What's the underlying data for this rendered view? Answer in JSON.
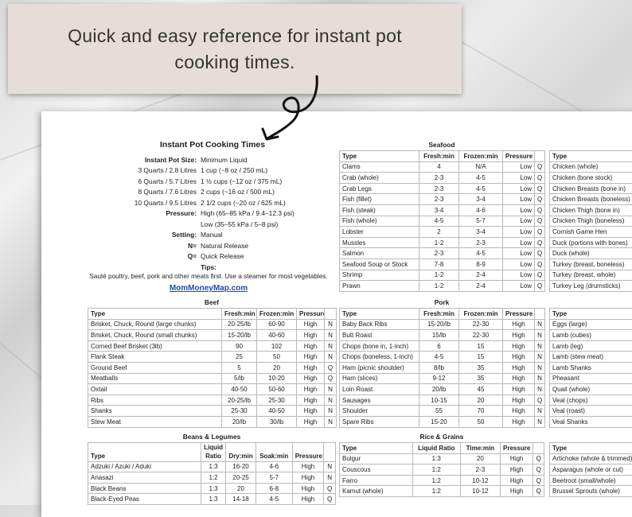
{
  "banner": {
    "text": "Quick and easy reference for instant pot cooking times."
  },
  "info": {
    "title": "Instant Pot Cooking Times",
    "rows": [
      {
        "k": "Instant Pot Size:",
        "v": "Minimum Liquid",
        "bold": true
      },
      {
        "k": "3 Quarts / 2.8 Litres",
        "v": "1 cup (~8 oz / 250 mL)",
        "bold": false
      },
      {
        "k": "6 Quarts / 5.7 Litres",
        "v": "1 ½ cups (~12 oz / 375 mL)",
        "bold": false
      },
      {
        "k": "8 Quarts / 7.6 Litres",
        "v": "2 cups (~16 oz / 500 mL)",
        "bold": false
      },
      {
        "k": "10 Quarts / 9.5 Litres",
        "v": "2 1/2 cups (~20 oz / 625 mL)",
        "bold": false
      },
      {
        "k": "Pressure:",
        "v": "High (65–85 kPa / 9.4–12.3 psi)",
        "bold": true
      },
      {
        "k": "",
        "v": "Low (35–55 kPa / 5–8 psi)",
        "bold": false
      },
      {
        "k": "Setting:",
        "v": "Manual",
        "bold": true
      },
      {
        "k": "N=",
        "v": "Natural Release",
        "bold": true
      },
      {
        "k": "Q=",
        "v": "Quick Release",
        "bold": true
      }
    ],
    "tips_title": "Tips:",
    "tips_text": "Sauté poultry, beef, pork and other meats first. Use a steamer for most vegetables.",
    "site": "MomMoneyMap.com"
  },
  "seafood": {
    "title": "Seafood",
    "headers": [
      "Type",
      "Fresh:min",
      "Frozen:min",
      "Pressure",
      ""
    ],
    "rows": [
      [
        "Clams",
        "4",
        "N/A",
        "Low",
        "Q"
      ],
      [
        "Crab (whole)",
        "2-3",
        "4-5",
        "Low",
        "Q"
      ],
      [
        "Crab Legs",
        "2-3",
        "4-5",
        "Low",
        "Q"
      ],
      [
        "Fish (fillet)",
        "2-3",
        "3-4",
        "Low",
        "Q"
      ],
      [
        "Fish (steak)",
        "3-4",
        "4-6",
        "Low",
        "Q"
      ],
      [
        "Fish (whole)",
        "4-5",
        "5-7",
        "Low",
        "Q"
      ],
      [
        "Lobster",
        "2",
        "3-4",
        "Low",
        "Q"
      ],
      [
        "Mussles",
        "1-2",
        "2-3",
        "Low",
        "Q"
      ],
      [
        "Salmon",
        "2-3",
        "4-5",
        "Low",
        "Q"
      ],
      [
        "Seafood Soup or Stock",
        "7-8",
        "8-9",
        "Low",
        "Q"
      ],
      [
        "Shrimp",
        "1-2",
        "2-4",
        "Low",
        "Q"
      ],
      [
        "Prawn",
        "1-2",
        "2-4",
        "Low",
        "Q"
      ]
    ]
  },
  "poultry": {
    "headers": [
      "Type"
    ],
    "rows": [
      "Chicken (whole)",
      "Chicken (bone stock)",
      "Chicken Breasts (bone in)",
      "Chicken Breasts (boneless)",
      "Chicken Thigh (bone in)",
      "Chicken Thigh (boneless)",
      "Cornish Game Hen",
      "Duck (portions with bones)",
      "Duck (whole)",
      "Turkey (breast, boneless)",
      "Turkey (breast, whole)",
      "Turkey Leg (drumsticks)"
    ]
  },
  "beef": {
    "title": "Beef",
    "headers": [
      "Type",
      "Fresh:min",
      "Frozen:min",
      "Pressure",
      ""
    ],
    "rows": [
      [
        "Brisket, Chuck, Round (large chunks)",
        "20-25/lb",
        "60-90",
        "High",
        "N"
      ],
      [
        "Brisket, Chuck, Round (small chunks)",
        "15-20/lb",
        "40-60",
        "High",
        "N"
      ],
      [
        "Corned Beef Brisket (3lb)",
        "90",
        "102",
        "High",
        "N"
      ],
      [
        "Flank Steak",
        "25",
        "50",
        "High",
        "N"
      ],
      [
        "Ground Beef",
        "5",
        "20",
        "High",
        "Q"
      ],
      [
        "Meatballs",
        "5/lb",
        "10-20",
        "High",
        "Q"
      ],
      [
        "Oxtail",
        "40-50",
        "50-60",
        "High",
        "N"
      ],
      [
        "Ribs",
        "20-25/lb",
        "25-30",
        "High",
        "N"
      ],
      [
        "Shanks",
        "25-30",
        "40-50",
        "High",
        "N"
      ],
      [
        "Stew Meat",
        "20/lb",
        "30/lb",
        "High",
        "N"
      ]
    ]
  },
  "pork": {
    "title": "Pork",
    "headers": [
      "Type",
      "Fresh:min",
      "Frozen:min",
      "Pressure",
      ""
    ],
    "rows": [
      [
        "Baby Back Ribs",
        "15-20/lb",
        "22-30",
        "High",
        "N"
      ],
      [
        "Butt Roast",
        "15/lb",
        "22-30",
        "High",
        "N"
      ],
      [
        "Chops (bone in, 1-inch)",
        "6",
        "15",
        "High",
        "N"
      ],
      [
        "Chops (boneless, 1-inch)",
        "4-5",
        "15",
        "High",
        "N"
      ],
      [
        "Ham (picnic shoulder)",
        "8/lb",
        "35",
        "High",
        "N"
      ],
      [
        "Ham (slices)",
        "9-12",
        "35",
        "High",
        "N"
      ],
      [
        "Loin Roast",
        "20/lb",
        "45",
        "High",
        "N"
      ],
      [
        "Sausages",
        "10-15",
        "20",
        "High",
        "Q"
      ],
      [
        "Shoulder",
        "55",
        "70",
        "High",
        "N"
      ],
      [
        "Spare Ribs",
        "15-20",
        "50",
        "High",
        "N"
      ]
    ]
  },
  "other": {
    "headers": [
      "Type"
    ],
    "rows": [
      "Eggs (large)",
      "Lamb (cubes)",
      "Lamb (leg)",
      "Lamb (stew meat)",
      "Lamb Shanks",
      "Pheasant",
      "Quail (whole)",
      "Veal (chops)",
      "Veal (roast)",
      "Veal Shanks"
    ]
  },
  "beans": {
    "title": "Beans & Legumes",
    "header_liquid_top": "Liquid",
    "headers": [
      "Type",
      "Ratio",
      "Dry:min",
      "Soak:min",
      "Pressure",
      ""
    ],
    "rows": [
      [
        "Adzuki / Azuki / Aduki",
        "1:3",
        "16-20",
        "4-6",
        "High",
        "N"
      ],
      [
        "Anasazi",
        "1:2",
        "20-25",
        "5-7",
        "High",
        "N"
      ],
      [
        "Black Beans",
        "1:3",
        "20",
        "6-8",
        "High",
        "Q"
      ],
      [
        "Black-Eyed Peas",
        "1:3",
        "14-18",
        "4-5",
        "High",
        "Q"
      ]
    ]
  },
  "rice": {
    "title": "Rice & Grains",
    "headers": [
      "Type",
      "Liquid Ratio",
      "Time:min",
      "Pressure",
      ""
    ],
    "rows": [
      [
        "Bulgur",
        "1:3",
        "20",
        "High",
        "Q"
      ],
      [
        "Couscous",
        "1:2",
        "2-3",
        "High",
        "Q"
      ],
      [
        "Farro",
        "1:2",
        "10-12",
        "High",
        "Q"
      ],
      [
        "Kamut (whole)",
        "1:2",
        "10-12",
        "High",
        "Q"
      ]
    ]
  },
  "veg": {
    "headers": [
      "Type"
    ],
    "rows": [
      "Artichoke (whole & trimmed)",
      "Asparagus (whole or cut)",
      "Beetroot (small/whole)",
      "Brussel Sprouts (whole)"
    ]
  }
}
